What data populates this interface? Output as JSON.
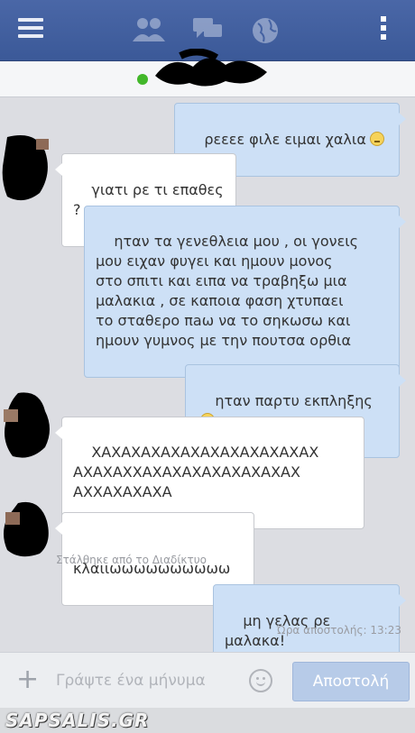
{
  "header": {
    "icons": [
      "menu-icon",
      "friends-icon",
      "messages-icon",
      "globe-icon",
      "more-icon"
    ]
  },
  "messages": [
    {
      "dir": "out",
      "text": "ρεεεε φιλε ειμαι χαλια",
      "emoji": "disappointed-emoji"
    },
    {
      "dir": "in",
      "text": "γιατι ρε τι επαθες ?"
    },
    {
      "dir": "out",
      "text": "ηταν τα γενεθλεια μου , οι γονεις\nμου ειχαν φυγει και ημουν μονος\nστο σπιτι και ειπα να τραβηξω μια\nμαλακια , σε καποια φαση χτυπαει\nτο σταθερο πaω να το σηκωσω και\nημουν γυμνος με την πουτσα ορθια"
    },
    {
      "dir": "out",
      "text": "ηταν παρτυ εκπληξης",
      "emoji": "disappointed-emoji"
    },
    {
      "dir": "in",
      "text": "ΧΑΧΑΧΑΧΑΧΑΧΑΧΑΧΑΧΑΧΑΧΑΧ\nΑΧΑΧΑΧΧΑΧΑΧΑΧΑΧΑΧΑΧΑΧΑΧ\nΑΧΧΑΧΑΧΑΧΑ"
    },
    {
      "dir": "in",
      "text": "κλαιιωωωωωωωωωω"
    },
    {
      "dir": "out",
      "text": "μη γελας ρε μαλακα!"
    }
  ],
  "sent_via": "Στάλθηκε από το Διαδίκτυο",
  "send_time": "Ώρα αποστολής: 13:23",
  "composer": {
    "placeholder": "Γράψτε ένα μήνυμα",
    "send_label": "Αποστολή"
  },
  "watermark": "SAPSALIS.GR"
}
